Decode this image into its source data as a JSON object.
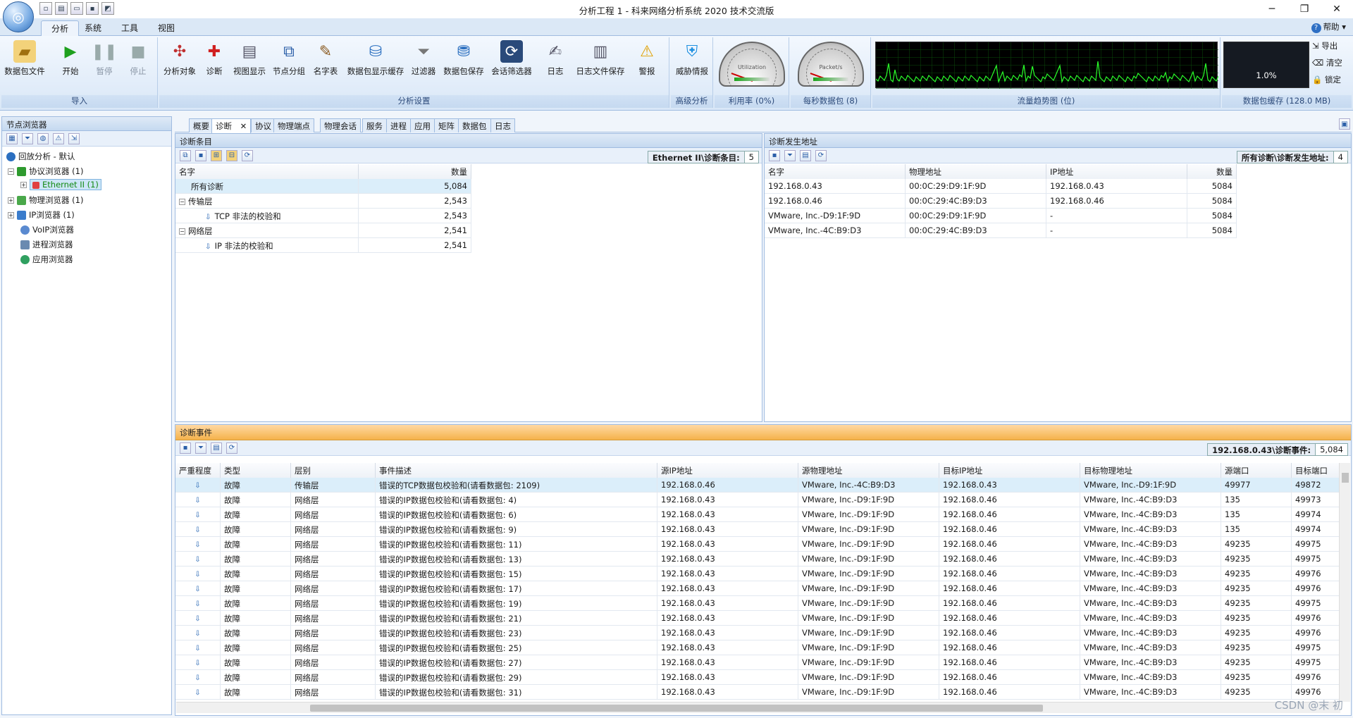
{
  "window": {
    "title": "分析工程 1 - 科来网络分析系统 2020 技术交流版",
    "controls": [
      "─",
      "❐",
      "✕"
    ]
  },
  "ribbon_tabs": [
    "分析",
    "系统",
    "工具",
    "视图"
  ],
  "help_label": "帮助",
  "ribbon": {
    "groups": [
      {
        "label": "导入",
        "buttons": [
          "数据包文件",
          "开始",
          "暂停",
          "停止"
        ]
      },
      {
        "label": "分析设置",
        "buttons": [
          "分析对象",
          "诊断",
          "视图显示",
          "节点分组",
          "名字表",
          "数据包显示缓存",
          "过滤器",
          "数据包保存",
          "会话筛选器",
          "日志",
          "日志文件保存",
          "警报"
        ]
      },
      {
        "label": "高级分析",
        "buttons": [
          "威胁情报"
        ]
      },
      {
        "label": "利用率 (0%)"
      },
      {
        "label": "每秒数据包 (8)"
      },
      {
        "label": "流量趋势图 (位)"
      },
      {
        "label": "数据包缓存 (128.0 MB)"
      }
    ],
    "gauge1_text": "Utilization",
    "gauge2_text": "Packet/s",
    "buffer_percent": "1.0%",
    "buffer_side_buttons": [
      "导出",
      "清空",
      "锁定"
    ]
  },
  "node_browser": {
    "title": "节点浏览器",
    "items": [
      {
        "label": "回放分析 - 默认"
      },
      {
        "label": "协议浏览器 (1)"
      },
      {
        "label": "Ethernet II (1)"
      },
      {
        "label": "物理浏览器 (1)"
      },
      {
        "label": "IP浏览器 (1)"
      },
      {
        "label": "VoIP浏览器"
      },
      {
        "label": "进程浏览器"
      },
      {
        "label": "应用浏览器"
      }
    ]
  },
  "main_tabs": [
    "概要",
    "诊断",
    "协议",
    "物理端点",
    "物理会话",
    "服务",
    "进程",
    "应用",
    "矩阵",
    "数据包",
    "日志"
  ],
  "diag_items": {
    "title": "诊断条目",
    "count_label": "Ethernet II\\诊断条目:",
    "count_value": "5",
    "columns": [
      "名字",
      "数量"
    ],
    "rows": [
      {
        "name": "所有诊断",
        "count": "5,084"
      },
      {
        "name": "传输层",
        "count": "2,543"
      },
      {
        "name": "TCP 非法的校验和",
        "count": "2,543"
      },
      {
        "name": "网络层",
        "count": "2,541"
      },
      {
        "name": "IP 非法的校验和",
        "count": "2,541"
      }
    ]
  },
  "diag_addresses": {
    "title": "诊断发生地址",
    "count_label": "所有诊断\\诊断发生地址:",
    "count_value": "4",
    "columns": [
      "名字",
      "物理地址",
      "IP地址",
      "数量"
    ],
    "rows": [
      [
        "192.168.0.43",
        "00:0C:29:D9:1F:9D",
        "192.168.0.43",
        "5084"
      ],
      [
        "192.168.0.46",
        "00:0C:29:4C:B9:D3",
        "192.168.0.46",
        "5084"
      ],
      [
        "VMware, Inc.-D9:1F:9D",
        "00:0C:29:D9:1F:9D",
        "-",
        "5084"
      ],
      [
        "VMware, Inc.-4C:B9:D3",
        "00:0C:29:4C:B9:D3",
        "-",
        "5084"
      ]
    ]
  },
  "diag_events": {
    "title": "诊断事件",
    "count_label": "192.168.0.43\\诊断事件:",
    "count_value": "5,084",
    "columns": [
      "严重程度",
      "类型",
      "层别",
      "事件描述",
      "源IP地址",
      "源物理地址",
      "目标IP地址",
      "目标物理地址",
      "源端口",
      "目标端口"
    ],
    "rows": [
      [
        "故障",
        "传输层",
        "错误的TCP数据包校验和(请看数据包: 2109)",
        "192.168.0.46",
        "VMware, Inc.-4C:B9:D3",
        "192.168.0.43",
        "VMware, Inc.-D9:1F:9D",
        "49977",
        "49872"
      ],
      [
        "故障",
        "网络层",
        "错误的IP数据包校验和(请看数据包: 4)",
        "192.168.0.43",
        "VMware, Inc.-D9:1F:9D",
        "192.168.0.46",
        "VMware, Inc.-4C:B9:D3",
        "135",
        "49973"
      ],
      [
        "故障",
        "网络层",
        "错误的IP数据包校验和(请看数据包: 6)",
        "192.168.0.43",
        "VMware, Inc.-D9:1F:9D",
        "192.168.0.46",
        "VMware, Inc.-4C:B9:D3",
        "135",
        "49974"
      ],
      [
        "故障",
        "网络层",
        "错误的IP数据包校验和(请看数据包: 9)",
        "192.168.0.43",
        "VMware, Inc.-D9:1F:9D",
        "192.168.0.46",
        "VMware, Inc.-4C:B9:D3",
        "135",
        "49974"
      ],
      [
        "故障",
        "网络层",
        "错误的IP数据包校验和(请看数据包: 11)",
        "192.168.0.43",
        "VMware, Inc.-D9:1F:9D",
        "192.168.0.46",
        "VMware, Inc.-4C:B9:D3",
        "49235",
        "49975"
      ],
      [
        "故障",
        "网络层",
        "错误的IP数据包校验和(请看数据包: 13)",
        "192.168.0.43",
        "VMware, Inc.-D9:1F:9D",
        "192.168.0.46",
        "VMware, Inc.-4C:B9:D3",
        "49235",
        "49975"
      ],
      [
        "故障",
        "网络层",
        "错误的IP数据包校验和(请看数据包: 15)",
        "192.168.0.43",
        "VMware, Inc.-D9:1F:9D",
        "192.168.0.46",
        "VMware, Inc.-4C:B9:D3",
        "49235",
        "49976"
      ],
      [
        "故障",
        "网络层",
        "错误的IP数据包校验和(请看数据包: 17)",
        "192.168.0.43",
        "VMware, Inc.-D9:1F:9D",
        "192.168.0.46",
        "VMware, Inc.-4C:B9:D3",
        "49235",
        "49976"
      ],
      [
        "故障",
        "网络层",
        "错误的IP数据包校验和(请看数据包: 19)",
        "192.168.0.43",
        "VMware, Inc.-D9:1F:9D",
        "192.168.0.46",
        "VMware, Inc.-4C:B9:D3",
        "49235",
        "49975"
      ],
      [
        "故障",
        "网络层",
        "错误的IP数据包校验和(请看数据包: 21)",
        "192.168.0.43",
        "VMware, Inc.-D9:1F:9D",
        "192.168.0.46",
        "VMware, Inc.-4C:B9:D3",
        "49235",
        "49976"
      ],
      [
        "故障",
        "网络层",
        "错误的IP数据包校验和(请看数据包: 23)",
        "192.168.0.43",
        "VMware, Inc.-D9:1F:9D",
        "192.168.0.46",
        "VMware, Inc.-4C:B9:D3",
        "49235",
        "49976"
      ],
      [
        "故障",
        "网络层",
        "错误的IP数据包校验和(请看数据包: 25)",
        "192.168.0.43",
        "VMware, Inc.-D9:1F:9D",
        "192.168.0.46",
        "VMware, Inc.-4C:B9:D3",
        "49235",
        "49975"
      ],
      [
        "故障",
        "网络层",
        "错误的IP数据包校验和(请看数据包: 27)",
        "192.168.0.43",
        "VMware, Inc.-D9:1F:9D",
        "192.168.0.46",
        "VMware, Inc.-4C:B9:D3",
        "49235",
        "49975"
      ],
      [
        "故障",
        "网络层",
        "错误的IP数据包校验和(请看数据包: 29)",
        "192.168.0.43",
        "VMware, Inc.-D9:1F:9D",
        "192.168.0.46",
        "VMware, Inc.-4C:B9:D3",
        "49235",
        "49976"
      ],
      [
        "故障",
        "网络层",
        "错误的IP数据包校验和(请看数据包: 31)",
        "192.168.0.43",
        "VMware, Inc.-D9:1F:9D",
        "192.168.0.46",
        "VMware, Inc.-4C:B9:D3",
        "49235",
        "49976"
      ]
    ]
  },
  "watermark": "CSDN @末 初",
  "colors": {
    "accent": "#f5b24b",
    "selection": "#cde6f7",
    "ribbon": "#dbe8f6"
  }
}
